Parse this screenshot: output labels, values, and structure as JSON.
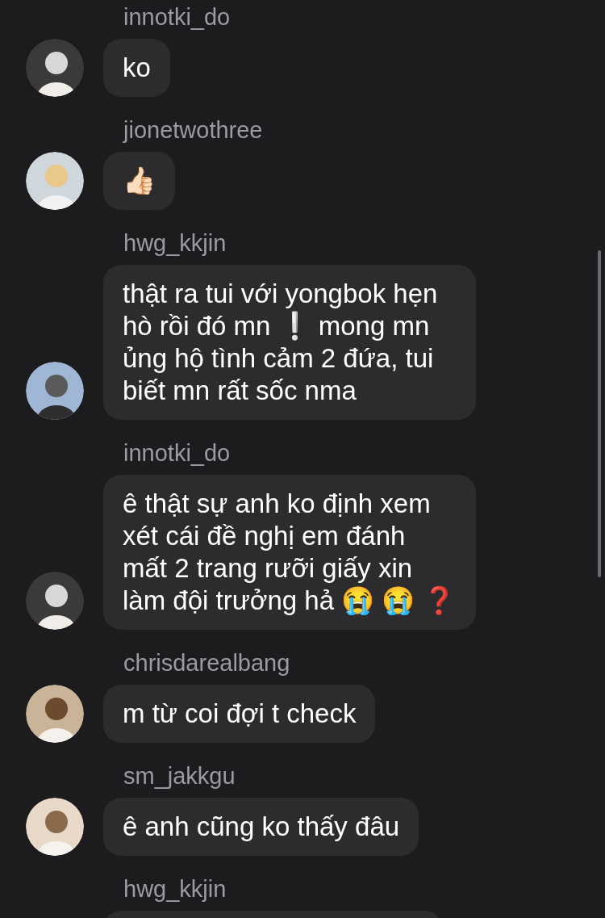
{
  "messages": [
    {
      "username": "innotki_do",
      "text": "ko"
    },
    {
      "username": "jionetwothree",
      "text": "👍🏻"
    },
    {
      "username": "hwg_kkjin",
      "text": "thật ra tui với yongbok hẹn hò rồi đó mn ❕ mong mn ủng hộ tình cảm 2 đứa, tui biết mn rất sốc nma"
    },
    {
      "username": "innotki_do",
      "text": "ê thật sự anh ko định xem xét cái đề nghị em đánh mất 2 trang rưỡi giấy xin làm đội trưởng hả 😭 😭 ❓"
    },
    {
      "username": "chrisdarealbang",
      "text": "m từ coi đợi t check"
    },
    {
      "username": "sm_jakkgu",
      "text": "ê anh cũng ko thấy đâu"
    },
    {
      "username": "hwg_kkjin"
    }
  ]
}
